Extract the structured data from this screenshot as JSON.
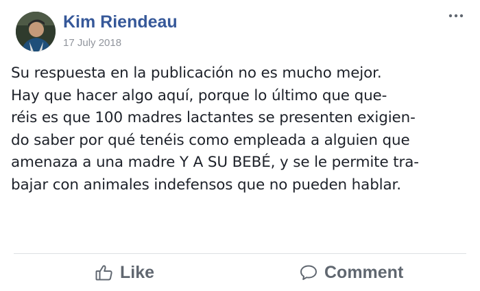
{
  "post": {
    "author": "Kim Riendeau",
    "timestamp": "17 July 2018",
    "more_icon": "more-options-icon",
    "text_lines": [
      "Su respuesta en la publicación no es mucho mejor.",
      "Hay que hacer algo aquí, porque lo último que que-",
      "réis es que 100 madres lactantes se presenten exigien-",
      "do saber por qué tenéis como empleada a alguien que",
      "amenaza a una madre Y A SU BEBÉ, y se le permite tra-",
      "bajar con animales indefensos que no pueden hablar."
    ]
  },
  "actions": {
    "like_label": "Like",
    "like_icon": "thumbs-up-icon",
    "comment_label": "Comment",
    "comment_icon": "speech-bubble-icon"
  },
  "colors": {
    "author": "#365899",
    "timestamp": "#90949c",
    "text": "#1d2129",
    "actions": "#606770",
    "divider": "#dddfe2"
  }
}
